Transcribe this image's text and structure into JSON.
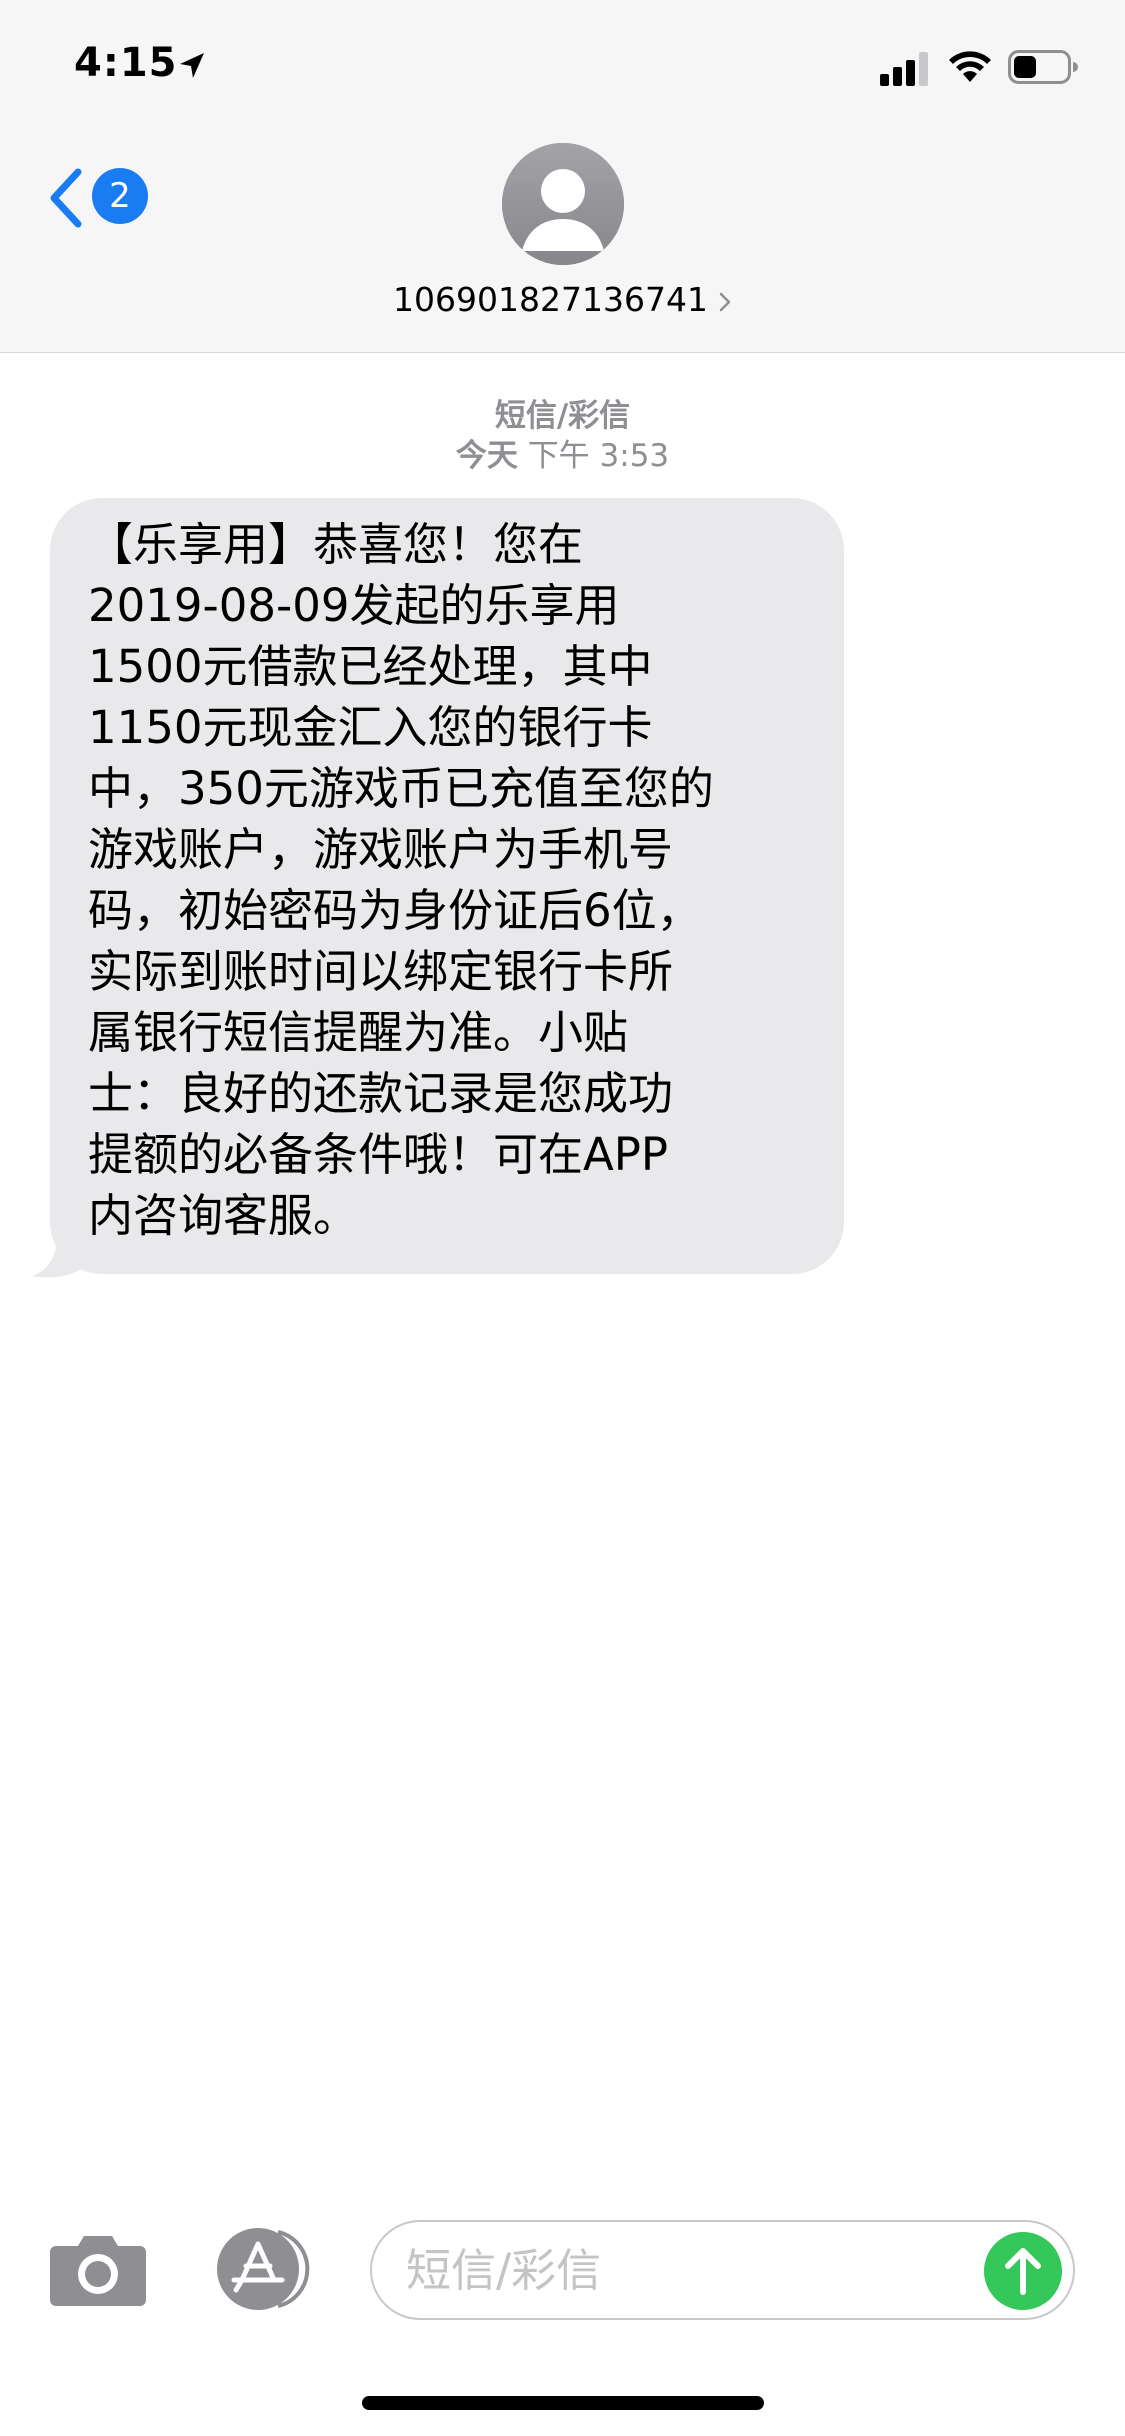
{
  "status_bar": {
    "time": "4:15"
  },
  "nav": {
    "unread_count": "2",
    "contact_number": "106901827136741"
  },
  "thread": {
    "message_type": "短信/彩信",
    "day": "今天",
    "time": "下午 3:53"
  },
  "message": {
    "text": "【乐享用】恭喜您！您在\n2019-08-09发起的乐享用\n1500元借款已经处理，其中\n1150元现金汇入您的银行卡\n中，350元游戏币已充值至您的\n游戏账户，游戏账户为手机号\n码，初始密码为身份证后6位，\n实际到账时间以绑定银行卡所\n属银行短信提醒为准。小贴\n士：良好的还款记录是您成功\n提额的必备条件哦！可在APP\n内咨询客服。"
  },
  "composer": {
    "placeholder": "短信/彩信"
  },
  "colors": {
    "accent_blue": "#1a7cf3",
    "send_green": "#34c759",
    "bubble_gray": "#e9e9eb",
    "meta_gray": "#8e8e93"
  },
  "icons": {
    "location": "location-arrow-icon",
    "signal": "cellular-signal-icon",
    "wifi": "wifi-icon",
    "battery": "battery-icon",
    "back": "chevron-left-icon",
    "avatar": "person-silhouette-icon",
    "camera": "camera-icon",
    "app_store": "app-store-icon",
    "send": "arrow-up-icon"
  }
}
